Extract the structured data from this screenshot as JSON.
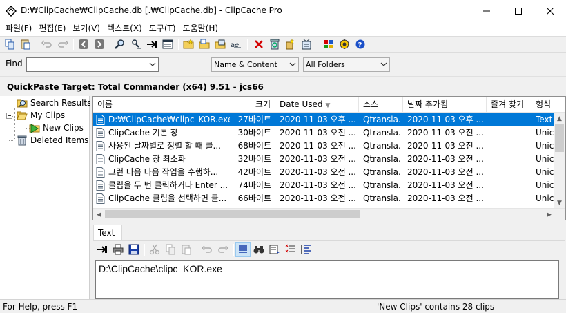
{
  "window": {
    "title": "D:₩ClipCache₩ClipCache.db [.₩ClipCache.db] - ClipCache Pro"
  },
  "menu": [
    "파일(F)",
    "편집(E)",
    "보기(V)",
    "텍스트(X)",
    "도구(T)",
    "도움말(H)"
  ],
  "find": {
    "label": "Find",
    "query": "",
    "mode": "Name & Content",
    "folder": "All Folders"
  },
  "quickpaste": {
    "text": "QuickPaste Target: Total Commander (x64) 9.51 - jcs66"
  },
  "tree": {
    "items": [
      "Search Results",
      "My Clips",
      "New Clips",
      "Deleted Items"
    ]
  },
  "list": {
    "columns": [
      "이름",
      "크기",
      "Date Used",
      "소스",
      "날짜 추가됨",
      "즐겨 찾기",
      "형식"
    ],
    "rows": [
      {
        "name": "D:₩ClipCache₩clipc_KOR.exe",
        "size": "27바이트",
        "used": "2020-11-03 오후 ...",
        "source": "Qtransla...",
        "added": "2020-11-03 오후 ...",
        "fav": "",
        "format": "Text"
      },
      {
        "name": "ClipCache 기본 창",
        "size": "30바이트",
        "used": "2020-11-03 오전 ...",
        "source": "Qtransla...",
        "added": "2020-11-03 오전 ...",
        "fav": "",
        "format": "Unic"
      },
      {
        "name": "사용된 날짜별로 정렬 할 때 클...",
        "size": "68바이트",
        "used": "2020-11-03 오전 ...",
        "source": "Qtransla...",
        "added": "2020-11-03 오전 ...",
        "fav": "",
        "format": "Unic"
      },
      {
        "name": "ClipCache 창 최소화",
        "size": "32바이트",
        "used": "2020-11-03 오전 ...",
        "source": "Qtransla...",
        "added": "2020-11-03 오전 ...",
        "fav": "",
        "format": "Unic"
      },
      {
        "name": "그런 다음 다음 작업을 수행하...",
        "size": "42바이트",
        "used": "2020-11-03 오전 ...",
        "source": "Qtransla...",
        "added": "2020-11-03 오전 ...",
        "fav": "",
        "format": "Unic"
      },
      {
        "name": "클립을 두 번 클릭하거나 Enter ...",
        "size": "74바이트",
        "used": "2020-11-03 오전 ...",
        "source": "Qtransla...",
        "added": "2020-11-03 오전 ...",
        "fav": "",
        "format": "Unic"
      },
      {
        "name": "ClipCache 클립을 선택하면 클...",
        "size": "66바이트",
        "used": "2020-11-03 오전 ...",
        "source": "Qtransla...",
        "added": "2020-11-03 오전 ...",
        "fav": "",
        "format": "Unic"
      }
    ]
  },
  "editor": {
    "tab": "Text",
    "content": "D:\\ClipCache\\clipc_KOR.exe"
  },
  "status": {
    "left": "For Help, press F1",
    "right": "'New Clips' contains 28 clips"
  }
}
